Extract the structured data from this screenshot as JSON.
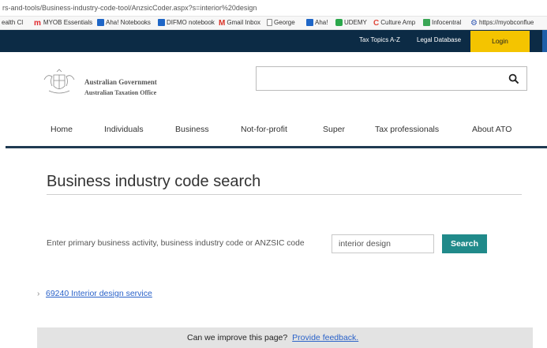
{
  "browser": {
    "url": "rs-and-tools/Business-industry-code-tool/AnzsicCoder.aspx?s=interior%20design",
    "bookmarks": [
      {
        "label": "ealth Cl",
        "icon": "page-icon"
      },
      {
        "label": "MYOB Essentials",
        "icon": "myob-m-icon"
      },
      {
        "label": "Aha! Notebooks",
        "icon": "aha-icon"
      },
      {
        "label": "DIFMO notebook",
        "icon": "aha-icon"
      },
      {
        "label": "Gmail Inbox",
        "icon": "gmail-icon"
      },
      {
        "label": "George",
        "icon": "document-icon"
      },
      {
        "label": "Aha!",
        "icon": "aha-icon"
      },
      {
        "label": "UDEMY",
        "icon": "udemy-icon"
      },
      {
        "label": "Culture Amp",
        "icon": "culture-amp-icon"
      },
      {
        "label": "Infocentral",
        "icon": "infocentral-icon"
      },
      {
        "label": "https://myobconflue",
        "icon": "myob-icon"
      }
    ]
  },
  "topbar": {
    "tax_topics": "Tax Topics A-Z",
    "legal_database": "Legal Database",
    "login": "Login"
  },
  "header": {
    "gov_name": "Australian Government",
    "agency_name": "Australian Taxation Office",
    "search_value": ""
  },
  "nav": [
    "Home",
    "Individuals",
    "Business",
    "Not-for-profit",
    "Super",
    "Tax professionals",
    "About ATO"
  ],
  "main": {
    "title": "Business industry code search",
    "search_label": "Enter primary business activity, business industry code or ANZSIC code",
    "search_value": "interior design",
    "search_button": "Search",
    "results": [
      "69240 Interior design service"
    ]
  },
  "feedback": {
    "question": "Can we improve this page?",
    "link": "Provide feedback."
  },
  "colors": {
    "topbar": "#0c2b45",
    "login": "#f4c400",
    "search_button": "#208a8a",
    "link": "#2a62c9",
    "feedback_bg": "#e3e3e3"
  }
}
